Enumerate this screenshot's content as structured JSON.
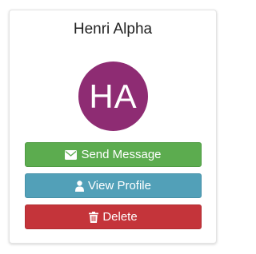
{
  "profile": {
    "name": "Henri Alpha",
    "initials": "HA",
    "avatar_color": "#8e2c73"
  },
  "actions": {
    "send_message": {
      "label": "Send Message",
      "icon": "envelope-icon",
      "color": "#5cac4f"
    },
    "view_profile": {
      "label": "View Profile",
      "icon": "user-icon",
      "color": "#52a0b8"
    },
    "delete": {
      "label": "Delete",
      "icon": "trash-icon",
      "color": "#c4343a"
    }
  }
}
